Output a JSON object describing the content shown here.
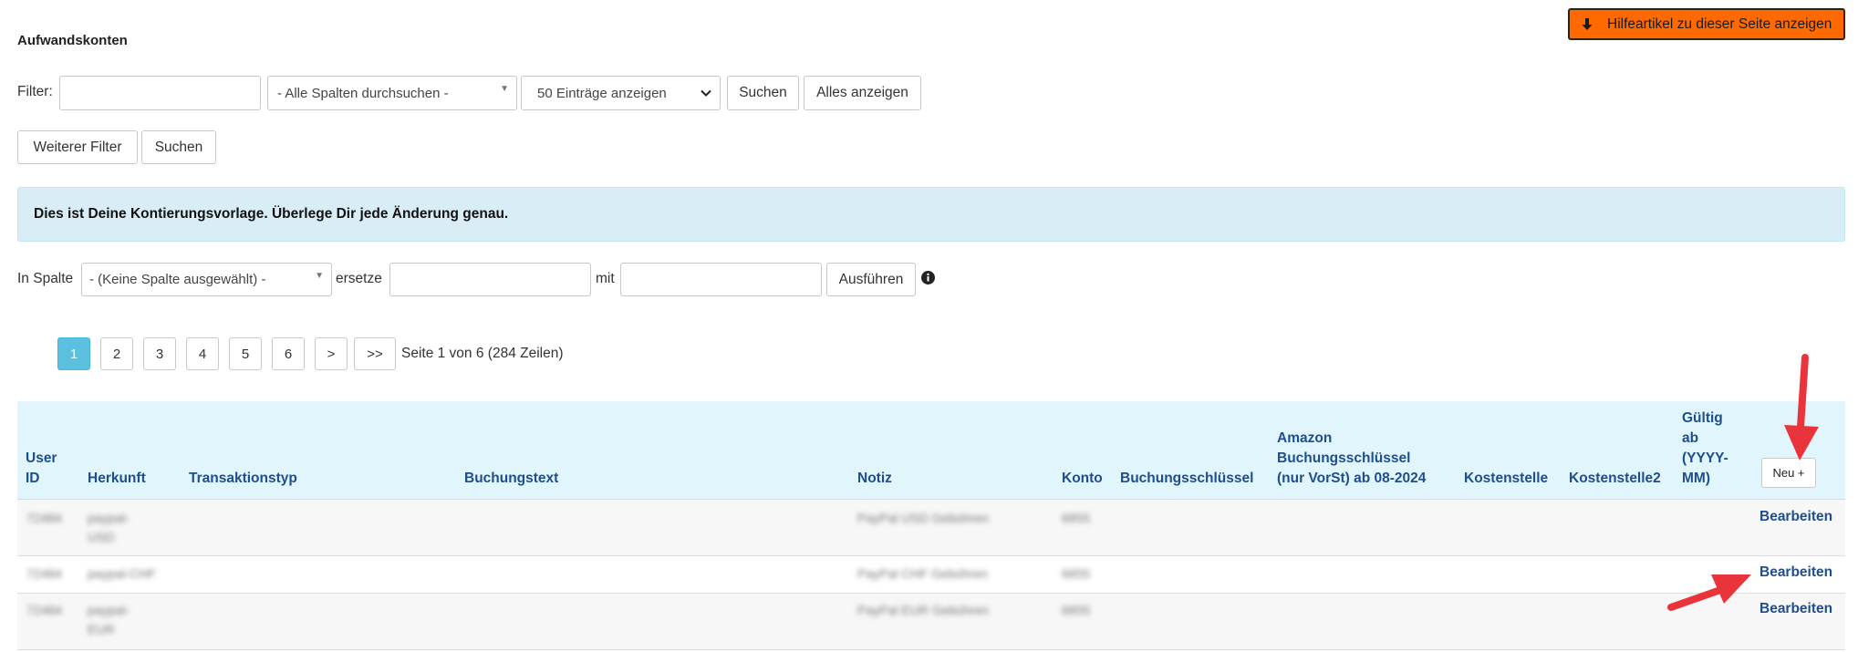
{
  "page_title": "Aufwandskonten",
  "help_button": "Hilfeartikel zu dieser Seite anzeigen",
  "filter": {
    "label": "Filter:",
    "input_value": "",
    "column_select": "- Alle Spalten durchsuchen -",
    "count_select": "50 Einträge anzeigen",
    "search_label": "Suchen",
    "show_all_label": "Alles anzeigen",
    "more_filter_label": "Weiterer Filter",
    "search2_label": "Suchen"
  },
  "notice": "Dies ist Deine Kontierungsvorlage. Überlege Dir jede Änderung genau.",
  "replace": {
    "label_column": "In Spalte",
    "column_select": "- (Keine Spalte ausgewählt) -",
    "label_replace": "ersetze",
    "label_with": "mit",
    "execute_label": "Ausführen"
  },
  "pagination": {
    "pages": [
      "1",
      "2",
      "3",
      "4",
      "5",
      "6",
      ">",
      ">>"
    ],
    "current": "1",
    "summary": "Seite 1 von 6 (284 Zeilen)"
  },
  "table": {
    "headers": {
      "user_id": [
        "User",
        "ID"
      ],
      "herkunft": "Herkunft",
      "transaktionstyp": "Transaktionstyp",
      "buchungstext": "Buchungstext",
      "notiz": "Notiz",
      "konto": "Konto",
      "buchungsschluessel": "Buchungsschlüssel",
      "amazon": [
        "Amazon",
        "Buchungsschlüssel",
        "(nur VorSt) ab 08-2024"
      ],
      "kostenstelle": "Kostenstelle",
      "kostenstelle2": "Kostenstelle2",
      "gueltig": [
        "Gültig",
        "ab",
        "(YYYY-",
        "MM)"
      ]
    },
    "new_label": "Neu +",
    "rows": [
      {
        "user_id": "72484",
        "herkunft": [
          "paypal-",
          "USD"
        ],
        "notiz": "PayPal USD Gebühren",
        "konto": "6855",
        "action": "Bearbeiten"
      },
      {
        "user_id": "72484",
        "herkunft": [
          "paypal-CHF"
        ],
        "notiz": "PayPal CHF Gebühren",
        "konto": "6855",
        "action": "Bearbeiten"
      },
      {
        "user_id": "72484",
        "herkunft": [
          "paypal-",
          "EUR"
        ],
        "notiz": "PayPal EUR Gebühren",
        "konto": "6855",
        "action": "Bearbeiten"
      }
    ]
  },
  "colors": {
    "accent_orange": "#ff6a00",
    "notice_bg": "#d9edf7",
    "header_bg": "#e1f5fd",
    "link": "#1f4e8c",
    "active_page": "#5bc0de",
    "arrow_red": "#e8343a"
  }
}
